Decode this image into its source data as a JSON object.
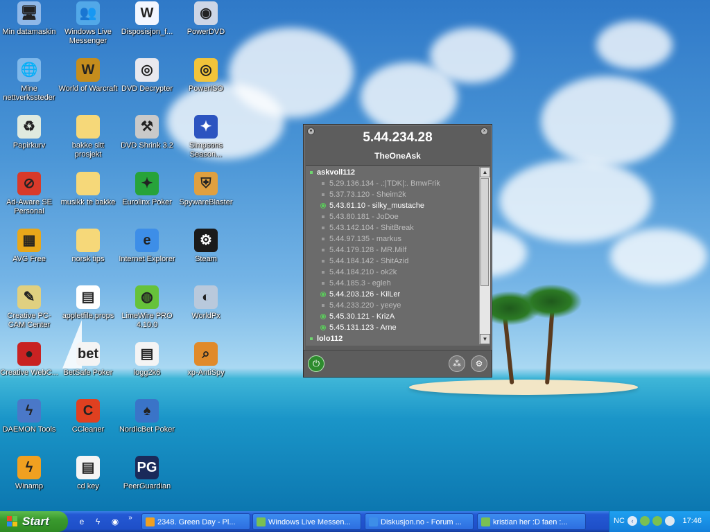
{
  "desktop": {
    "icons": [
      {
        "label": "Min datamaskin",
        "icon": "my-computer-icon",
        "glyph": "🖥",
        "color": "#8fb8e8"
      },
      {
        "label": "Windows Live Messenger",
        "icon": "messenger-icon",
        "glyph": "👥",
        "color": "#52a8e8"
      },
      {
        "label": "Disposisjon_f...",
        "icon": "word-document-icon",
        "glyph": "W",
        "color": "#f2f6ff"
      },
      {
        "label": "PowerDVD",
        "icon": "powerdvd-icon",
        "glyph": "◉",
        "color": "#cdd6e6"
      },
      {
        "label": "Mine nettverkssteder",
        "icon": "network-places-icon",
        "glyph": "🌐",
        "color": "#7fb8ea"
      },
      {
        "label": "World of Warcraft",
        "icon": "wow-icon",
        "glyph": "W",
        "color": "#c58d1d"
      },
      {
        "label": "DVD Decrypter",
        "icon": "dvd-decrypter-icon",
        "glyph": "◎",
        "color": "#e8e8ee"
      },
      {
        "label": "PowerISO",
        "icon": "poweriso-icon",
        "glyph": "◎",
        "color": "#f2c43a"
      },
      {
        "label": "Papirkurv",
        "icon": "recycle-bin-icon",
        "glyph": "♻",
        "color": "#dfeadf"
      },
      {
        "label": "bakke sitt prosjekt",
        "icon": "folder-icon",
        "glyph": "",
        "color": "#f6d879"
      },
      {
        "label": "DVD Shrink 3.2",
        "icon": "dvd-shrink-icon",
        "glyph": "⚒",
        "color": "#c9c9c9"
      },
      {
        "label": "Simpsons Season...",
        "icon": "simpsons-icon",
        "glyph": "✦",
        "color": "#2c54c0"
      },
      {
        "label": "Ad-Aware SE Personal",
        "icon": "ad-aware-icon",
        "glyph": "⊘",
        "color": "#d83a2a"
      },
      {
        "label": "musikk te bakke",
        "icon": "folder-icon",
        "glyph": "",
        "color": "#f6d879"
      },
      {
        "label": "Eurolinx Poker",
        "icon": "eurolinx-poker-icon",
        "glyph": "✦",
        "color": "#27a33a"
      },
      {
        "label": "SpywareBlaster",
        "icon": "spywareblaster-icon",
        "glyph": "⛨",
        "color": "#e0a040"
      },
      {
        "label": "AVG Free",
        "icon": "avg-icon",
        "glyph": "▦",
        "color": "#e8a71a"
      },
      {
        "label": "norsk tips",
        "icon": "folder-icon",
        "glyph": "",
        "color": "#f6d879"
      },
      {
        "label": "Internet Explorer",
        "icon": "internet-explorer-icon",
        "glyph": "e",
        "color": "#3d8ee8"
      },
      {
        "label": "Steam",
        "icon": "steam-icon",
        "glyph": "⚙",
        "color": "#1a1a1a"
      },
      {
        "label": "Creative PC-CAM Center",
        "icon": "creative-pccam-icon",
        "glyph": "✎",
        "color": "#e0d080"
      },
      {
        "label": "appletfile.props",
        "icon": "props-file-icon",
        "glyph": "▤",
        "color": "#ffffff"
      },
      {
        "label": "LimeWire PRO 4.10.0",
        "icon": "limewire-icon",
        "glyph": "◍",
        "color": "#66c23a"
      },
      {
        "label": "WorldPx",
        "icon": "worldpx-icon",
        "glyph": "◐",
        "color": "#b9c9dc"
      },
      {
        "label": "Creative WebC...",
        "icon": "creative-webcam-icon",
        "glyph": "●",
        "color": "#c82222"
      },
      {
        "label": "BetSafe Poker",
        "icon": "betsafe-poker-icon",
        "glyph": "bet",
        "color": "#f4f4f4"
      },
      {
        "label": "logg2k6",
        "icon": "text-file-icon",
        "glyph": "▤",
        "color": "#f4f4f4"
      },
      {
        "label": "xp-AntiSpy",
        "icon": "xp-antispy-icon",
        "glyph": "⌕",
        "color": "#e08a2a"
      },
      {
        "label": "DAEMON Tools",
        "icon": "daemon-tools-icon",
        "glyph": "ϟ",
        "color": "#4a78c8"
      },
      {
        "label": "CCleaner",
        "icon": "ccleaner-icon",
        "glyph": "C",
        "color": "#e04020"
      },
      {
        "label": "NordicBet Poker",
        "icon": "nordicbet-poker-icon",
        "glyph": "♠",
        "color": "#3a74c8"
      },
      {
        "label": "",
        "icon": "empty-slot",
        "glyph": "",
        "color": ""
      },
      {
        "label": "Winamp",
        "icon": "winamp-icon",
        "glyph": "ϟ",
        "color": "#f0a020"
      },
      {
        "label": "cd key",
        "icon": "text-file-icon",
        "glyph": "▤",
        "color": "#f4f4f4"
      },
      {
        "label": "PeerGuardian",
        "icon": "peerguardian-icon",
        "glyph": "PG",
        "color": "#1a2a5a"
      }
    ]
  },
  "window": {
    "ip": "5.44.234.28",
    "nickname": "TheOneAsk",
    "groups": [
      {
        "name": "askvoll112",
        "members": [
          {
            "text": "5.29.136.134 - .:|TDK|:. BmwFrik",
            "online": false
          },
          {
            "text": "5.37.73.120 - Sheim2k",
            "online": false
          },
          {
            "text": "5.43.61.10 - silky_mustache",
            "online": true
          },
          {
            "text": "5.43.80.181 - JoDoe",
            "online": false
          },
          {
            "text": "5.43.142.104 - ShitBreak",
            "online": false
          },
          {
            "text": "5.44.97.135 - markus",
            "online": false
          },
          {
            "text": "5.44.179.128 - MR.Milf",
            "online": false
          },
          {
            "text": "5.44.184.142 - ShitAzid",
            "online": false
          },
          {
            "text": "5.44.184.210 - ok2k",
            "online": false
          },
          {
            "text": "5.44.185.3 - egleh",
            "online": false
          },
          {
            "text": "5.44.203.126 - KilLer",
            "online": true
          },
          {
            "text": "5.44.233.220 - yeeye",
            "online": false
          },
          {
            "text": "5.45.30.121 - KrizA",
            "online": true
          },
          {
            "text": "5.45.131.123 - Arne",
            "online": true
          }
        ]
      },
      {
        "name": "lolo112",
        "members": []
      }
    ]
  },
  "taskbar": {
    "start_label": "Start",
    "tasks": [
      {
        "label": "2348. Green Day - Pl...",
        "icon": "winamp-task-icon",
        "color": "#f0a020"
      },
      {
        "label": "Windows Live Messen...",
        "icon": "messenger-task-icon",
        "color": "#7ac052"
      },
      {
        "label": "Diskusjon.no - Forum ...",
        "icon": "ie-task-icon",
        "color": "#3d8ee8"
      },
      {
        "label": "kristian her :D faen :...",
        "icon": "messenger-chat-task-icon",
        "color": "#7ac052"
      }
    ],
    "tray": {
      "nc": "NC",
      "clock": "17:46"
    }
  }
}
